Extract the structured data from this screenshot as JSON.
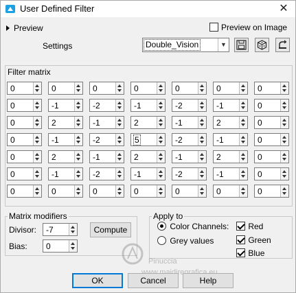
{
  "window": {
    "title": "User Defined Filter"
  },
  "preview": {
    "label": "Preview",
    "on_image_label": "Preview on Image",
    "on_image_checked": false
  },
  "settings": {
    "label": "Settings",
    "selected": "Double_Vision"
  },
  "toolbar": {
    "save_icon": "save-icon",
    "random_icon": "dice-icon",
    "reset_icon": "reset-icon"
  },
  "filter_matrix": {
    "title": "Filter matrix",
    "rows": [
      [
        "0",
        "0",
        "0",
        "0",
        "0",
        "0",
        "0"
      ],
      [
        "0",
        "-1",
        "-2",
        "-1",
        "-2",
        "-1",
        "0"
      ],
      [
        "0",
        "2",
        "-1",
        "2",
        "-1",
        "2",
        "0"
      ],
      [
        "0",
        "-1",
        "-2",
        "5",
        "-2",
        "-1",
        "0"
      ],
      [
        "0",
        "2",
        "-1",
        "2",
        "-1",
        "2",
        "0"
      ],
      [
        "0",
        "-1",
        "-2",
        "-1",
        "-2",
        "-1",
        "0"
      ],
      [
        "0",
        "0",
        "0",
        "0",
        "0",
        "0",
        "0"
      ]
    ]
  },
  "modifiers": {
    "title": "Matrix modifiers",
    "divisor_label": "Divisor:",
    "divisor": "-7",
    "compute_label": "Compute",
    "bias_label": "Bias:",
    "bias": "0"
  },
  "apply_to": {
    "title": "Apply to",
    "color_channels_label": "Color Channels:",
    "grey_values_label": "Grey values",
    "red_label": "Red",
    "green_label": "Green",
    "blue_label": "Blue"
  },
  "buttons": {
    "ok": "OK",
    "cancel": "Cancel",
    "help": "Help"
  },
  "watermark": {
    "name": "Pinuccia",
    "site": "www.maidiregrafica.eu"
  }
}
